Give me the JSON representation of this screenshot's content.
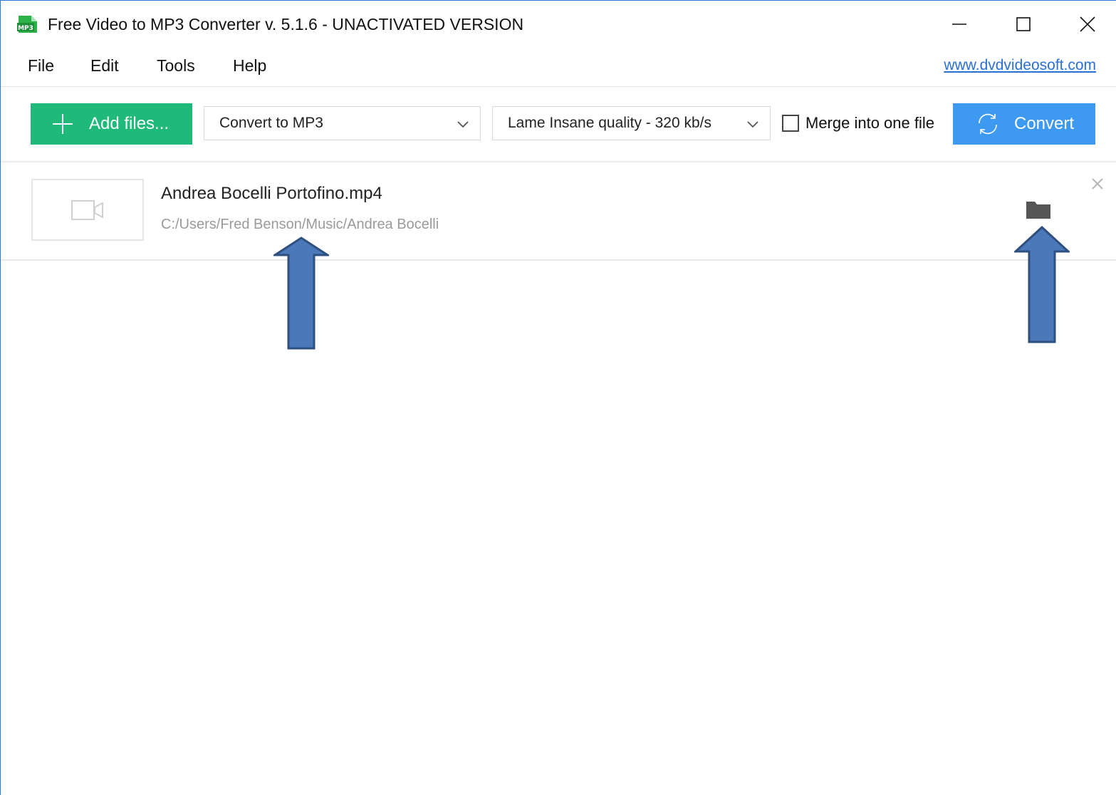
{
  "window": {
    "title": "Free Video to MP3 Converter v. 5.1.6 - UNACTIVATED VERSION",
    "app_icon_label": "MP3",
    "controls": [
      "minimize-icon",
      "maximize-icon",
      "close-icon"
    ]
  },
  "menu": {
    "items": [
      {
        "label": "File"
      },
      {
        "label": "Edit"
      },
      {
        "label": "Tools"
      },
      {
        "label": "Help"
      }
    ],
    "site_link": "www.dvdvideosoft.com"
  },
  "toolbar": {
    "add_label": "Add files...",
    "format_value": "Convert to MP3",
    "quality_value": "Lame Insane quality - 320 kb/s",
    "merge_label": "Merge into one file",
    "merge_checked": false,
    "convert_label": "Convert"
  },
  "files": [
    {
      "name": "Andrea Bocelli Portofino.mp4",
      "path": "C:/Users/Fred Benson/Music/Andrea Bocelli"
    }
  ],
  "colors": {
    "add_button": "#1fb97a",
    "convert_button": "#3d9af0",
    "link": "#2a6fd6",
    "annotation_arrow": "#4a78b8",
    "window_border": "#2b79d8"
  },
  "icons": {
    "app": "mp3-app-icon",
    "add": "plus-icon",
    "convert": "sync-icon",
    "thumb": "video-camera-icon",
    "folder": "folder-icon",
    "remove": "remove-icon",
    "dropdown": "chevron-down-icon"
  }
}
